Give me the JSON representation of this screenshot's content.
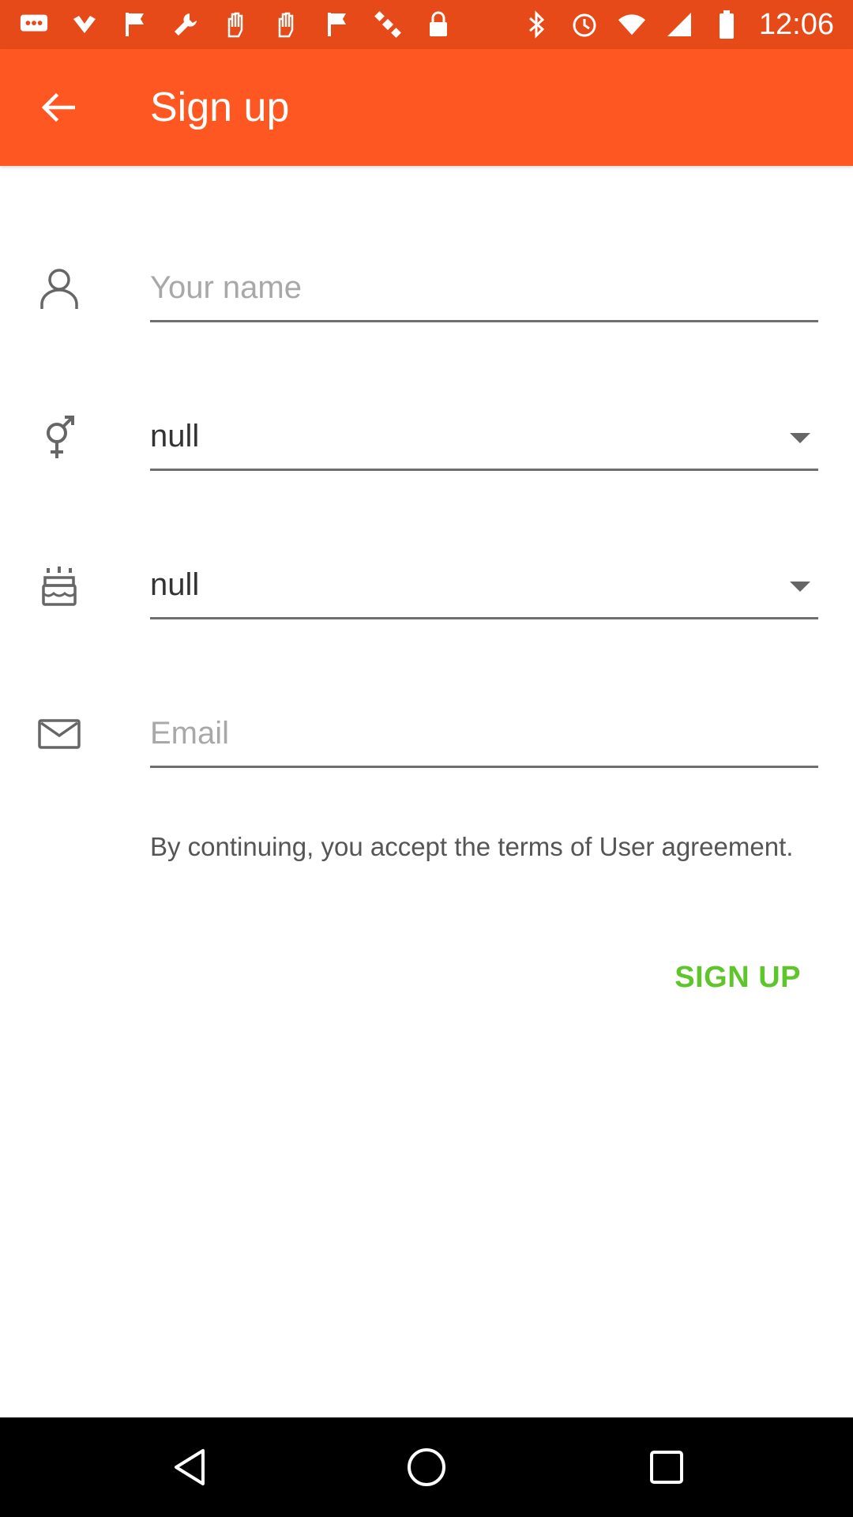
{
  "status_bar": {
    "time": "12:06",
    "left_icons": [
      "chat-icon",
      "check-icon",
      "flag-icon",
      "wrench-icon",
      "hand-icon",
      "hand-icon",
      "flag-icon",
      "satellite-icon",
      "lock-icon"
    ],
    "right_icons": [
      "bluetooth-icon",
      "alarm-icon",
      "wifi-icon",
      "signal-icon",
      "battery-icon"
    ],
    "color": "#e64a19"
  },
  "app_bar": {
    "title": "Sign up",
    "back_icon": "arrow-back-icon",
    "color": "#ff5722"
  },
  "form": {
    "name": {
      "icon": "person-icon",
      "placeholder": "Your name",
      "value": ""
    },
    "gender": {
      "icon": "gender-icon",
      "value": "null"
    },
    "birthday": {
      "icon": "cake-icon",
      "value": "null"
    },
    "email": {
      "icon": "mail-icon",
      "placeholder": "Email",
      "value": ""
    }
  },
  "terms_text": "By continuing, you accept the terms of User agreement.",
  "signup_label": "SIGN UP",
  "accent_color": "#5ec52b",
  "nav_bar": {
    "icons": [
      "back-nav-icon",
      "home-nav-icon",
      "recents-nav-icon"
    ]
  }
}
